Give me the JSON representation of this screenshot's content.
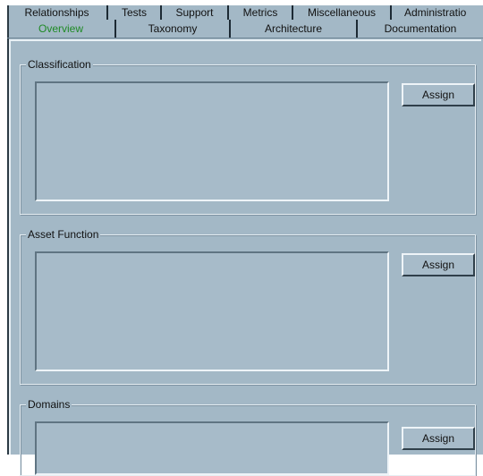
{
  "tabs_back": [
    {
      "label": "Relationships"
    },
    {
      "label": "Tests"
    },
    {
      "label": "Support"
    },
    {
      "label": "Metrics"
    },
    {
      "label": "Miscellaneous"
    },
    {
      "label": "Administratio"
    }
  ],
  "tabs_front": [
    {
      "label": "Overview",
      "active": true
    },
    {
      "label": "Taxonomy"
    },
    {
      "label": "Architecture"
    },
    {
      "label": "Documentation"
    }
  ],
  "groups": [
    {
      "title": "Classification",
      "button": "Assign"
    },
    {
      "title": "Asset Function",
      "button": "Assign"
    },
    {
      "title": "Domains",
      "button": "Assign"
    }
  ],
  "colors": {
    "background": "#a3b8c6",
    "active_tab_text": "#1f8a25"
  }
}
